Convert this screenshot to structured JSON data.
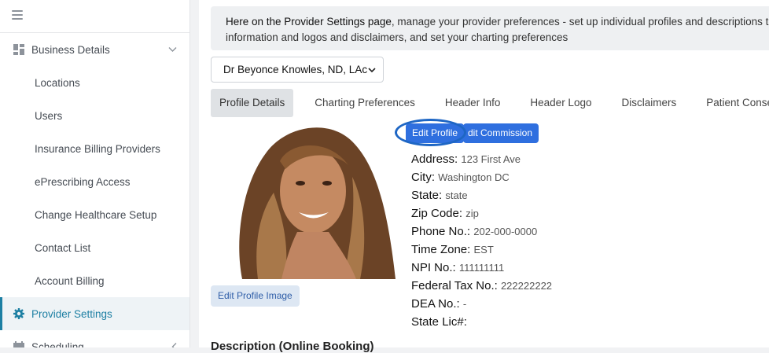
{
  "sidebar": {
    "menu_icon": "hamburger-icon",
    "items": [
      {
        "label": "Business Details",
        "icon": "dashboard-icon",
        "chevron": "chevron-down-icon"
      },
      {
        "label": "Locations"
      },
      {
        "label": "Users"
      },
      {
        "label": "Insurance Billing Providers"
      },
      {
        "label": "ePrescribing Access"
      },
      {
        "label": "Change Healthcare Setup"
      },
      {
        "label": "Contact List"
      },
      {
        "label": "Account Billing"
      },
      {
        "label": "Provider Settings",
        "icon": "gear-icon",
        "active": true
      },
      {
        "label": "Scheduling",
        "icon": "calendar-icon",
        "chevron": "chevron-left-icon"
      }
    ]
  },
  "banner": {
    "bold": "Here on the Provider Settings page",
    "text": ", manage your provider preferences - set up individual profiles and descriptions to fe",
    "line2": "information and logos and disclaimers, and set your charting preferences"
  },
  "provider_select": {
    "value": "Dr Beyonce Knowles, ND, LAc"
  },
  "tabs": [
    "Profile Details",
    "Charting Preferences",
    "Header Info",
    "Header Logo",
    "Disclaimers",
    "Patient Conse"
  ],
  "buttons": {
    "edit_profile": "Edit Profile",
    "edit_commission": "dit Commission",
    "edit_profile_image": "Edit Profile Image"
  },
  "profile": [
    {
      "label": "Address:",
      "value": "123 First Ave"
    },
    {
      "label": "City:",
      "value": "Washington DC"
    },
    {
      "label": "State:",
      "value": "state"
    },
    {
      "label": "Zip Code:",
      "value": "zip"
    },
    {
      "label": "Phone No.:",
      "value": "202-000-0000"
    },
    {
      "label": "Time Zone:",
      "value": "EST"
    },
    {
      "label": "NPI No.:",
      "value": "111111111"
    },
    {
      "label": "Federal Tax No.:",
      "value": "222222222"
    },
    {
      "label": "DEA No.:",
      "value": "-"
    },
    {
      "label": "State Lic#:",
      "value": ""
    }
  ],
  "description_heading": "Description (Online Booking)",
  "colors": {
    "accent": "#1d7fa3",
    "primary_button": "#2f6fdf",
    "highlight_ring": "#1e66c4"
  }
}
